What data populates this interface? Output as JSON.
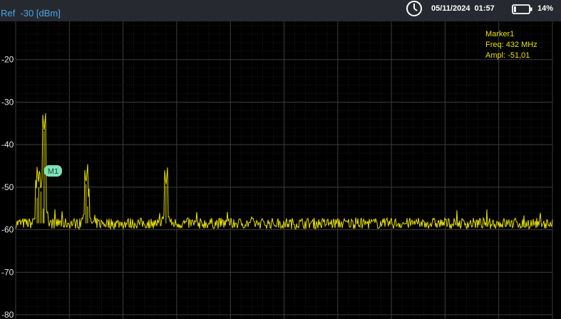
{
  "header": {
    "ref_prefix": "Ref",
    "ref_value": "-30 [dBm]",
    "datetime": "05/11/2024  01:57",
    "battery_percent": "14%",
    "battery_level": 0.14,
    "icons": [
      "clock-icon",
      "battery-icon"
    ]
  },
  "marker": {
    "title": "Marker1",
    "freq": "Freq: 432 MHz",
    "ampl": "Ampl: -51,01",
    "badge": "M1"
  },
  "colors": {
    "accent": "#4aa3e8",
    "trace": "#e8e000",
    "grid": "#3c3c3c",
    "marker_badge": "#7ee2b8"
  },
  "chart_data": {
    "type": "line",
    "y_ticks": [
      "-20",
      "-30",
      "-40",
      "-50",
      "-60",
      "-70",
      "-80"
    ],
    "ylim": [
      -81,
      -11
    ],
    "noise_floor": -58.5,
    "grid": true,
    "peaks": [
      {
        "x": 0.053,
        "y": -36.8
      },
      {
        "x": 0.047,
        "y": -51.0
      },
      {
        "x": 0.043,
        "y": -50.0
      },
      {
        "x": 0.04,
        "y": -52.5
      },
      {
        "x": 0.051,
        "y": -55.0
      },
      {
        "x": 0.131,
        "y": -49.3
      },
      {
        "x": 0.134,
        "y": -54.5
      },
      {
        "x": 0.28,
        "y": -49.7
      }
    ]
  }
}
